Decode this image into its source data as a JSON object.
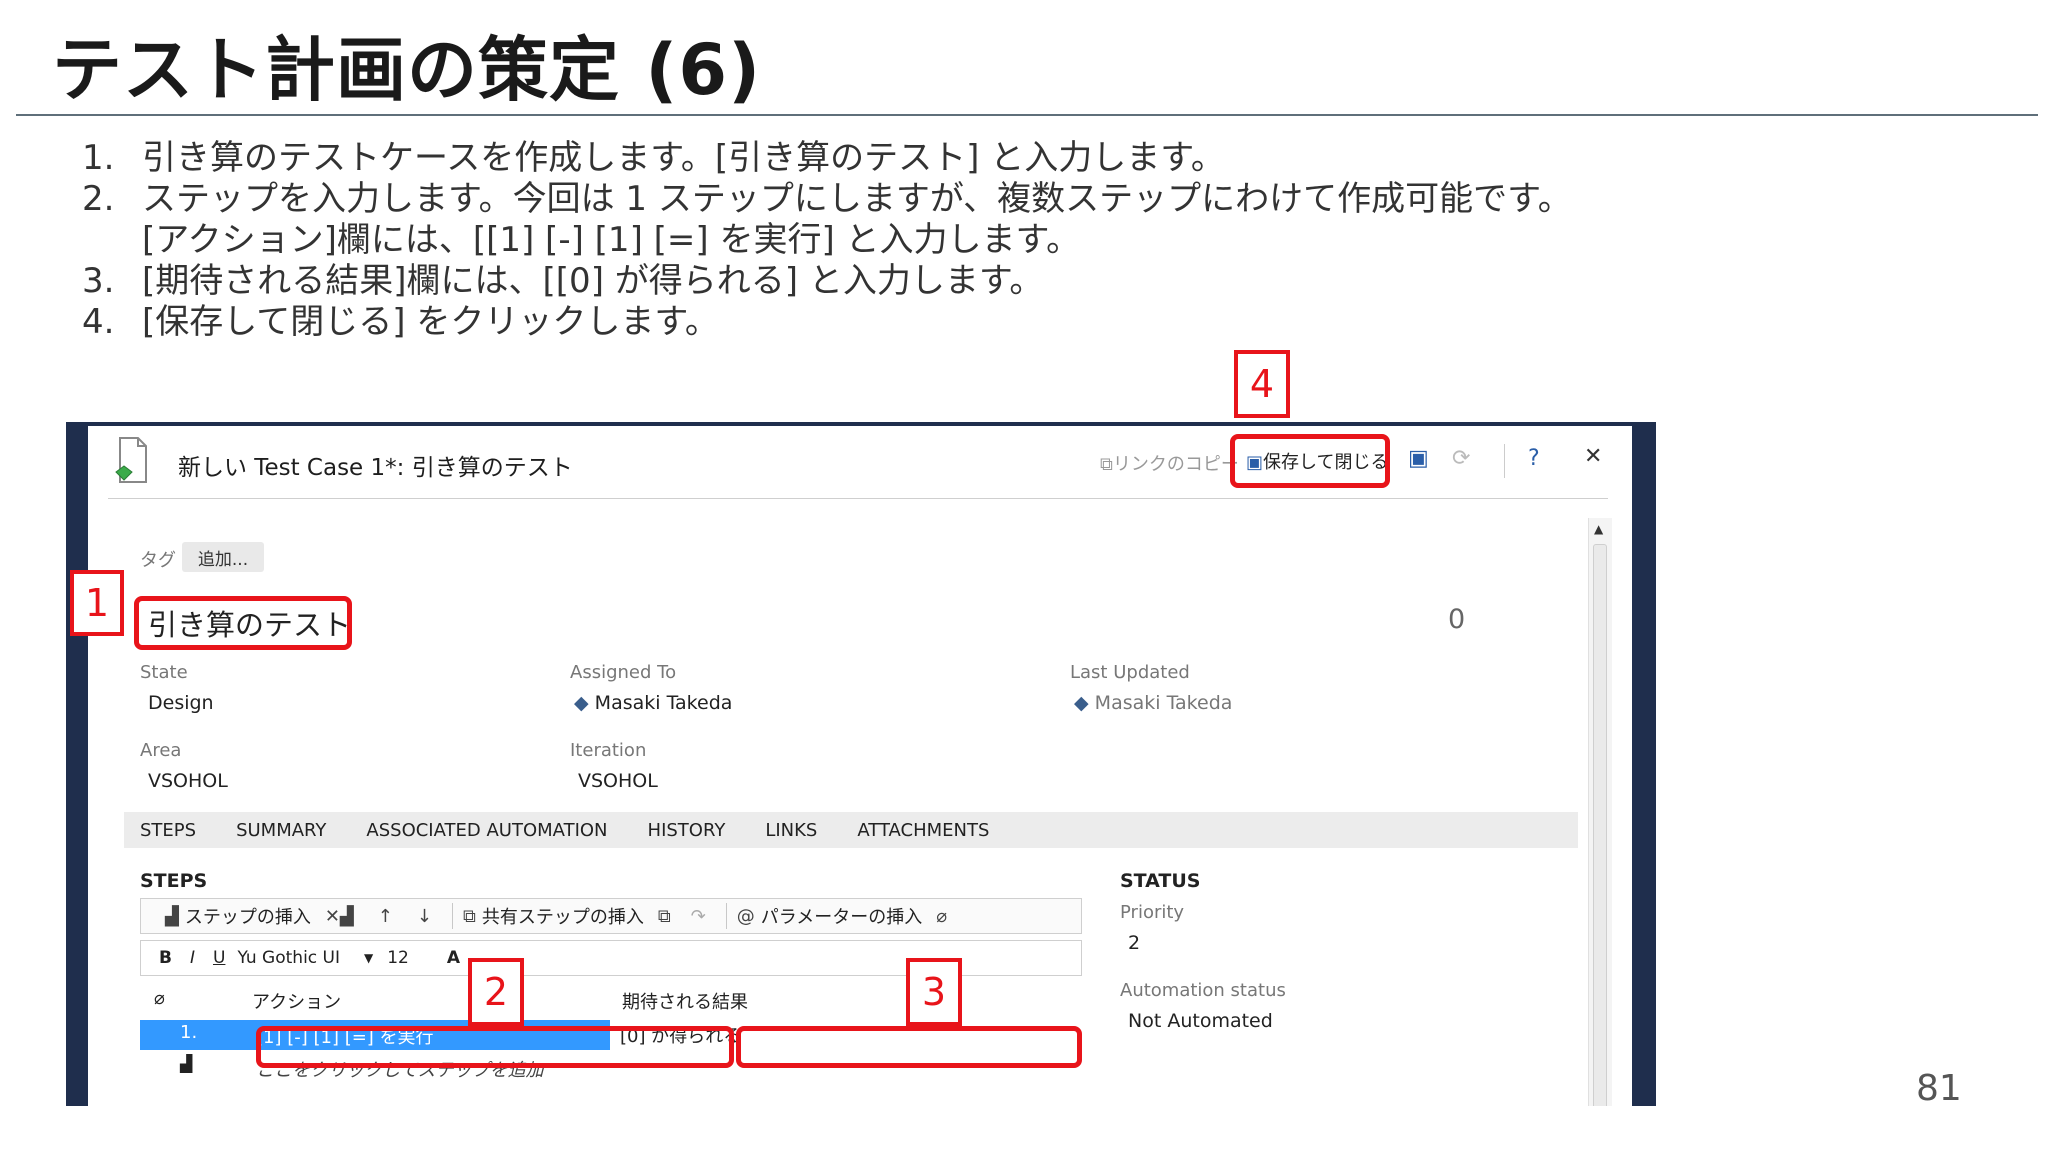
{
  "slide": {
    "title": "テスト計画の策定 (6)",
    "page_number": "81",
    "instructions": [
      {
        "num": "1.",
        "text": "引き算のテストケースを作成します。[引き算のテスト] と入力します。"
      },
      {
        "num": "2.",
        "text": "ステップを入力します。今回は 1 ステップにしますが、複数ステップにわけて作成可能です。"
      },
      {
        "num": "",
        "text": "[アクション]欄には、[[1] [-] [1] [=] を実行] と入力します。"
      },
      {
        "num": "3.",
        "text": "[期待される結果]欄には、[[0] が得られる] と入力します。"
      },
      {
        "num": "4.",
        "text": "[保存して閉じる] をクリックします。"
      }
    ],
    "callouts": [
      "1",
      "2",
      "3",
      "4"
    ],
    "accent_color": "#e8141a"
  },
  "window": {
    "title": "新しい Test Case 1*: 引き算のテスト",
    "toolbar": {
      "copy_link": "リンクのコピー",
      "save_close": "保存して閉じる"
    },
    "tags_label": "タグ",
    "tags_add": "追加...",
    "tc_title": "引き算のテスト",
    "tc_id": "0",
    "fields": {
      "state_label": "State",
      "state_value": "Design",
      "assigned_label": "Assigned To",
      "assigned_value": "Masaki Takeda",
      "updated_label": "Last Updated",
      "updated_value": "Masaki Takeda",
      "area_label": "Area",
      "area_value": "VSOHOL",
      "iteration_label": "Iteration",
      "iteration_value": "VSOHOL"
    },
    "tabs": [
      "STEPS",
      "SUMMARY",
      "ASSOCIATED AUTOMATION",
      "HISTORY",
      "LINKS",
      "ATTACHMENTS"
    ],
    "steps": {
      "heading": "STEPS",
      "toolbar": {
        "insert_step": "ステップの挿入",
        "insert_shared": "共有ステップの挿入",
        "insert_param": "パラメーターの挿入"
      },
      "format": {
        "bold": "B",
        "italic": "I",
        "underline": "U",
        "font": "Yu Gothic UI",
        "size": "12",
        "color_letter": "A"
      },
      "col_action": "アクション",
      "col_expected": "期待される結果",
      "rows": [
        {
          "num": "1.",
          "action": "[1] [-] [1] [=] を実行",
          "expected": "[0] が得られる"
        }
      ],
      "add_hint": "ここをクリックしてステップを追加"
    },
    "status": {
      "heading": "STATUS",
      "priority_label": "Priority",
      "priority_value": "2",
      "automation_label": "Automation status",
      "automation_value": "Not Automated"
    }
  }
}
